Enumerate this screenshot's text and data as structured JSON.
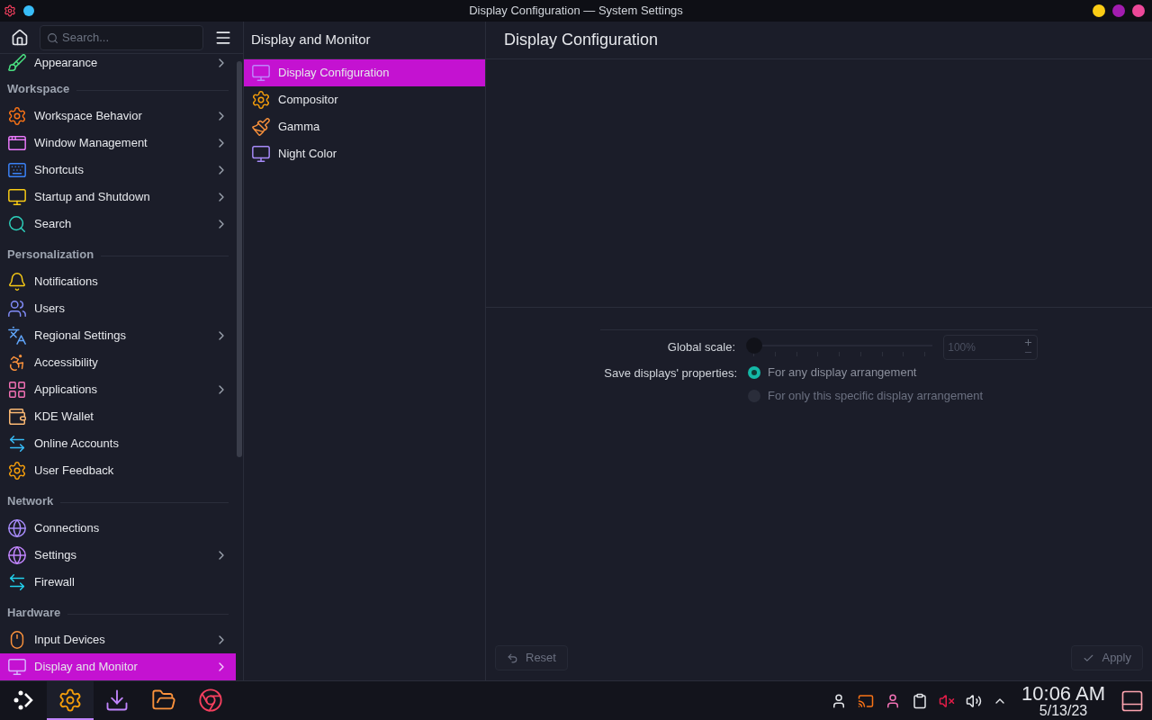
{
  "window": {
    "title": "Display Configuration — System Settings"
  },
  "sidebar": {
    "search": {
      "placeholder": "Search..."
    },
    "items": [
      {
        "kind": "item",
        "label": "Appearance",
        "has_children": true,
        "selected": false
      },
      {
        "kind": "header",
        "label": "Workspace"
      },
      {
        "kind": "item",
        "label": "Workspace Behavior",
        "has_children": true,
        "selected": false
      },
      {
        "kind": "item",
        "label": "Window Management",
        "has_children": true,
        "selected": false
      },
      {
        "kind": "item",
        "label": "Shortcuts",
        "has_children": true,
        "selected": false
      },
      {
        "kind": "item",
        "label": "Startup and Shutdown",
        "has_children": true,
        "selected": false
      },
      {
        "kind": "item",
        "label": "Search",
        "has_children": true,
        "selected": false
      },
      {
        "kind": "header",
        "label": "Personalization"
      },
      {
        "kind": "item",
        "label": "Notifications",
        "has_children": false,
        "selected": false
      },
      {
        "kind": "item",
        "label": "Users",
        "has_children": false,
        "selected": false
      },
      {
        "kind": "item",
        "label": "Regional Settings",
        "has_children": true,
        "selected": false
      },
      {
        "kind": "item",
        "label": "Accessibility",
        "has_children": false,
        "selected": false
      },
      {
        "kind": "item",
        "label": "Applications",
        "has_children": true,
        "selected": false
      },
      {
        "kind": "item",
        "label": "KDE Wallet",
        "has_children": false,
        "selected": false
      },
      {
        "kind": "item",
        "label": "Online Accounts",
        "has_children": false,
        "selected": false
      },
      {
        "kind": "item",
        "label": "User Feedback",
        "has_children": false,
        "selected": false
      },
      {
        "kind": "header",
        "label": "Network"
      },
      {
        "kind": "item",
        "label": "Connections",
        "has_children": false,
        "selected": false
      },
      {
        "kind": "item",
        "label": "Settings",
        "has_children": true,
        "selected": false
      },
      {
        "kind": "item",
        "label": "Firewall",
        "has_children": false,
        "selected": false
      },
      {
        "kind": "header",
        "label": "Hardware"
      },
      {
        "kind": "item",
        "label": "Input Devices",
        "has_children": true,
        "selected": false
      },
      {
        "kind": "item",
        "label": "Display and Monitor",
        "has_children": true,
        "selected": true
      }
    ]
  },
  "subpanel": {
    "title": "Display and Monitor",
    "items": [
      {
        "label": "Display Configuration",
        "selected": true
      },
      {
        "label": "Compositor",
        "selected": false
      },
      {
        "label": "Gamma",
        "selected": false
      },
      {
        "label": "Night Color",
        "selected": false
      }
    ]
  },
  "content": {
    "title": "Display Configuration",
    "global_scale": {
      "label": "Global scale:",
      "level": 0,
      "value": "100%",
      "disabled": true
    },
    "save_properties": {
      "label": "Save displays' properties:",
      "options": [
        {
          "label": "For any display arrangement",
          "selected": true,
          "disabled": false
        },
        {
          "label": "For only this specific display arrangement",
          "selected": false,
          "disabled": true
        }
      ]
    },
    "buttons": [
      {
        "kind": "reset",
        "label": "Reset",
        "disabled": true
      },
      {
        "kind": "apply",
        "label": "Apply",
        "disabled": true
      }
    ]
  },
  "taskbar": {
    "launchers": [
      {
        "selected": false
      },
      {
        "selected": true
      },
      {
        "selected": false
      },
      {
        "selected": false
      },
      {
        "selected": false
      }
    ],
    "time": "10:06 AM",
    "date": "5/13/23"
  }
}
